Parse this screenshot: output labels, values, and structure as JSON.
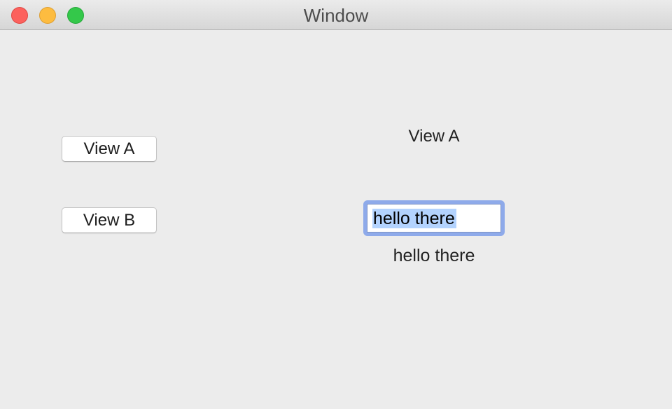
{
  "window": {
    "title": "Window"
  },
  "buttons": {
    "view_a_label": "View A",
    "view_b_label": "View B"
  },
  "main": {
    "current_view_label": "View A",
    "text_field_value": "hello there",
    "echo_text": "hello there"
  },
  "colors": {
    "close": "#fc615d",
    "minimize": "#fdbc40",
    "maximize": "#34c84a",
    "focus_ring": "#8eaaea",
    "selection": "#b3d3fe"
  }
}
